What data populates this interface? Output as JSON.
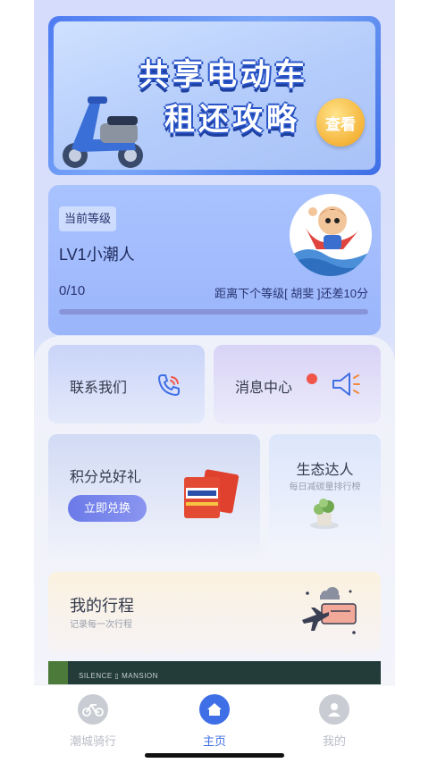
{
  "banner": {
    "line1": "共享电动车",
    "line2": "租还攻略",
    "view_button": "查看"
  },
  "level": {
    "tag": "当前等级",
    "name": "LV1小潮人",
    "progress_text": "0/10",
    "progress_fraction": 0.0,
    "gap_text": "距离下个等级[ 胡斐 ]还差10分"
  },
  "tiles": {
    "contact": {
      "label": "联系我们"
    },
    "message": {
      "label": "消息中心"
    },
    "points": {
      "label": "积分兑好礼",
      "button": "立即兑换"
    },
    "eco": {
      "label": "生态达人",
      "sub": "每日减碳量排行榜"
    },
    "trip": {
      "label": "我的行程",
      "sub": "记录每一次行程"
    }
  },
  "strip": {
    "text": "SILENCE ▯ MANSION"
  },
  "tabbar": {
    "items": [
      {
        "label": "潮城骑行",
        "icon": "bicycle-icon",
        "active": false
      },
      {
        "label": "主页",
        "icon": "home-icon",
        "active": true
      },
      {
        "label": "我的",
        "icon": "user-icon",
        "active": false
      }
    ]
  },
  "colors": {
    "accent": "#3f6fe6",
    "notification_dot": "#f0554a",
    "redeem_button": "#6b7ae8"
  }
}
